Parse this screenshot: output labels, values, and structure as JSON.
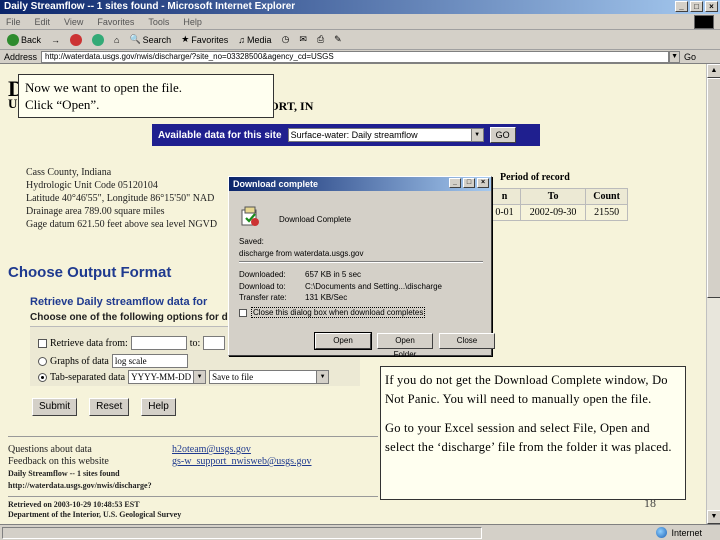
{
  "window": {
    "title": "Daily Streamflow -- 1 sites found - Microsoft Internet Explorer"
  },
  "menu": [
    "File",
    "Edit",
    "View",
    "Favorites",
    "Tools",
    "Help"
  ],
  "toolbar": {
    "back": "Back",
    "search": "Search",
    "favorites": "Favorites",
    "media": "Media"
  },
  "address": {
    "label": "Address",
    "url": "http://waterdata.usgs.gov/nwis/discharge/?site_no=03328500&agency_cd=USGS",
    "go": "Go"
  },
  "page": {
    "heading_left": "D",
    "heading_right": "n",
    "subheading_left": "U",
    "subheading_right": "PORT, IN",
    "available_label": "Available data for this site",
    "available_select": "Surface-water: Daily streamflow",
    "available_go": "GO",
    "site_info": [
      "Cass County, Indiana",
      "Hydrologic Unit Code 05120104",
      "Latitude 40°46'55\", Longitude 86°15'50\" NAD",
      "Drainage area 789.00  square miles",
      "Gage datum 621.50 feet above sea level NGVD"
    ],
    "period": {
      "label": "Period of record",
      "headers": [
        "n",
        "To",
        "Count"
      ],
      "row": [
        "0-01",
        "2002-09-30",
        "21550"
      ]
    },
    "output_heading": "Choose Output Format",
    "retrieve_heading": "Retrieve Daily streamflow data for",
    "choose_sub": "Choose one of the following options for dis",
    "options": {
      "retrieve_from": "Retrieve data from:",
      "to": "to:",
      "graphs": "Graphs of data",
      "graphs_select": "log scale",
      "tab": "Tab-separated data",
      "date_format": "YYYY-MM-DD",
      "save_select": "Save to file"
    },
    "buttons": {
      "submit": "Submit",
      "reset": "Reset",
      "help": "Help"
    },
    "footer": {
      "questions_label": "Questions about data",
      "questions_link": "h2oteam@usgs.gov",
      "feedback_label": "Feedback on this website",
      "feedback_link": "gs-w_support_nwisweb@usgs.gov",
      "page_title": "Daily Streamflow -- 1 sites found",
      "page_url": "http://waterdata.usgs.gov/nwis/discharge?",
      "retrieved": "Retrieved on 2003-10-29 10:48:53 EST",
      "dept": "Department of the Interior, U.S. Geological Survey"
    }
  },
  "dialog": {
    "title": "Download complete",
    "heading": "Download Complete",
    "saved_label": "Saved:",
    "saved_file": "discharge from waterdata.usgs.gov",
    "downloaded_label": "Downloaded:",
    "downloaded_value": "657 KB in 5 sec",
    "download_to_label": "Download to:",
    "download_to_value": "C:\\Documents and Setting...\\discharge",
    "transfer_label": "Transfer rate:",
    "transfer_value": "131 KB/Sec",
    "close_checkbox": "Close this dialog box when download completes",
    "open": "Open",
    "open_folder": "Open Folder",
    "close": "Close"
  },
  "callouts": {
    "top_line1": "Now we want to open the file.",
    "top_line2": "Click “Open”.",
    "bottom_p1": "If you do not get the Download Complete window, Do Not Panic.  You will need to manually open the file.",
    "bottom_p2": "Go to your Excel session and select File, Open and select the ‘discharge’ file from the folder it was placed."
  },
  "slide_number": "18",
  "status": {
    "zone": "Internet"
  }
}
